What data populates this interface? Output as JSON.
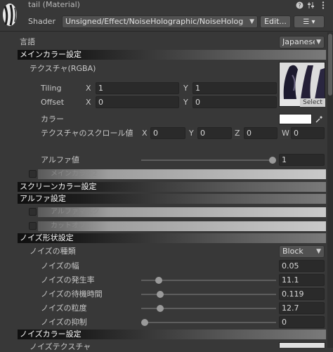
{
  "header": {
    "title": "tail (Material)",
    "shader_label": "Shader",
    "shader_value": "Unsigned/Effect/NoiseHolographic/NoiseHolog",
    "edit_label": "Edit...",
    "list_icon": "list-icon"
  },
  "language": {
    "label": "言語",
    "value": "Japanese"
  },
  "main_color": {
    "title": "メインカラー設定",
    "texture_label": "テクスチャ(RGBA)",
    "select_label": "Select",
    "tiling_label": "Tiling",
    "tiling_x": "1",
    "tiling_y": "1",
    "offset_label": "Offset",
    "offset_x": "0",
    "offset_y": "0",
    "color_label": "カラー",
    "color_value": "#ffffff",
    "scroll_label": "テクスチャのスクロール値",
    "scroll_x": "0",
    "scroll_y": "0",
    "scroll_z": "0",
    "scroll_w": "0",
    "alpha_label": "アルファ値",
    "alpha_value": "1",
    "alpha_slider": 1.0,
    "sub_section": "メインカラー2"
  },
  "axes": {
    "x": "X",
    "y": "Y",
    "z": "Z",
    "w": "W"
  },
  "screen_color": {
    "title": "スクリーンカラー設定"
  },
  "alpha_settings": {
    "title": "アルファ設定",
    "alpha_mask": "アルファマスク",
    "cutoff": "カットオフ"
  },
  "noise_shape": {
    "title": "ノイズ形状設定",
    "type_label": "ノイズの種類",
    "type_value": "Block",
    "width_label": "ノイズの幅",
    "width_value": "0.05",
    "rate_label": "ノイズの発生率",
    "rate_value": "11.1",
    "rate_slider": 0.11,
    "wait_label": "ノイズの待機時間",
    "wait_value": "0.119",
    "wait_slider": 0.12,
    "grain_label": "ノイズの粒度",
    "grain_value": "12.7",
    "grain_slider": 0.12,
    "suppress_label": "ノイズの抑制",
    "suppress_value": "0",
    "suppress_slider": 0.0
  },
  "noise_color": {
    "title": "ノイズカラー設定",
    "texture_label": "ノイズテクスチャ"
  },
  "colors": {
    "background": "#383838",
    "field": "#2a2a2a",
    "header_text": "#ffffff"
  }
}
